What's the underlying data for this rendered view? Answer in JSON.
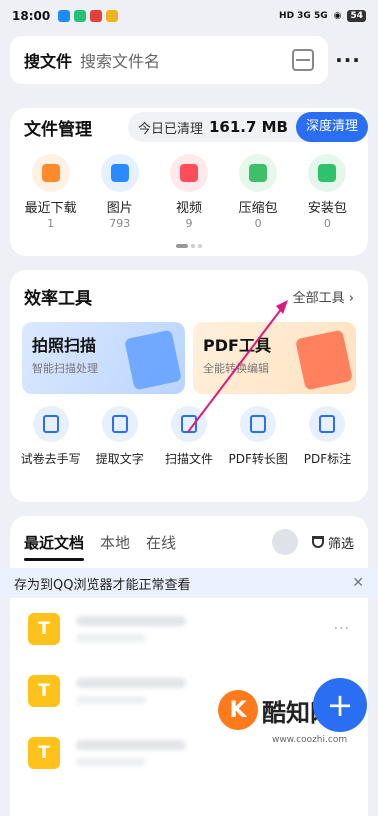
{
  "status_bar": {
    "time": "18:00",
    "right_icons": "HD 3G 5G",
    "battery": "54"
  },
  "search": {
    "label": "搜文件",
    "placeholder": "搜索文件名"
  },
  "file_mgmt": {
    "title": "文件管理",
    "cleaned_label": "今日已清理",
    "cleaned_value": "161.7 MB",
    "deep_clean": "深度清理",
    "items": [
      {
        "label": "最近下载",
        "count": "1",
        "color": "#ff8a2a",
        "bg": "#fff1e4"
      },
      {
        "label": "图片",
        "count": "793",
        "color": "#2a8bff",
        "bg": "#e6f1ff"
      },
      {
        "label": "视频",
        "count": "9",
        "color": "#ff4d5a",
        "bg": "#ffe9ea"
      },
      {
        "label": "压缩包",
        "count": "0",
        "color": "#3fbf6a",
        "bg": "#e7f7ec"
      },
      {
        "label": "安装包",
        "count": "0",
        "color": "#2ec26b",
        "bg": "#e5f7ec"
      }
    ]
  },
  "tools": {
    "title": "效率工具",
    "all_tools": "全部工具 ›",
    "banner1": {
      "title": "拍照扫描",
      "sub": "智能扫描处理"
    },
    "banner2": {
      "title": "PDF工具",
      "sub": "全能转换编辑"
    },
    "items": [
      {
        "label": "试卷去手写"
      },
      {
        "label": "提取文字"
      },
      {
        "label": "扫描文件"
      },
      {
        "label": "PDF转长图"
      },
      {
        "label": "PDF标注"
      }
    ]
  },
  "recent": {
    "tabs": [
      "最近文档",
      "本地",
      "在线"
    ],
    "filter": "筛选",
    "notice": "存为到QQ浏览器才能正常查看",
    "file_icon_letter": "T",
    "more": "···"
  },
  "fab": {
    "label": "+"
  },
  "watermark": {
    "brand": "酷知网",
    "url": "www.coozhi.com",
    "logo_letter": "K"
  }
}
